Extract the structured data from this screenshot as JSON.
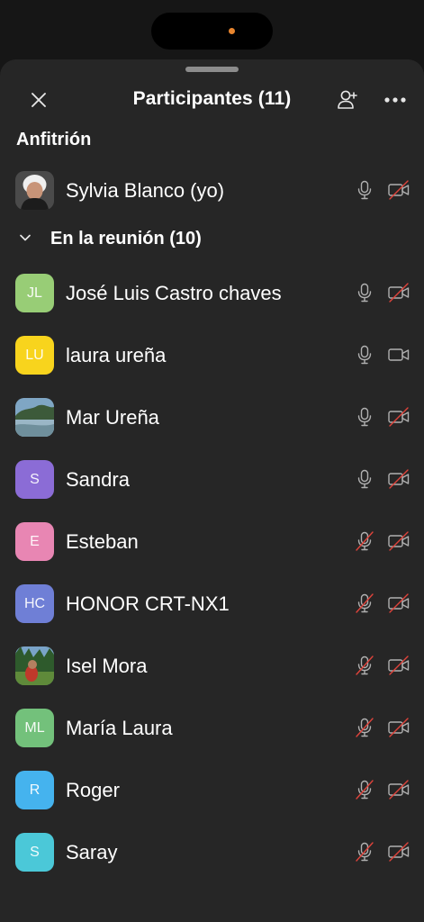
{
  "header": {
    "title": "Participantes (11)"
  },
  "host": {
    "section_label": "Anfitrión",
    "name": "Sylvia Blanco (yo)",
    "mic_muted": false,
    "cam_off": true
  },
  "group": {
    "label": "En la reunión (10)",
    "expanded": true
  },
  "participants": [
    {
      "initials": "JL",
      "name": "José Luis Castro chaves",
      "color": "#98cd76",
      "mic_muted": false,
      "cam_off": true
    },
    {
      "initials": "LU",
      "name": "laura ureña",
      "color": "#f8d41d",
      "mic_muted": false,
      "cam_off": false
    },
    {
      "initials": "",
      "name": "Mar Ureña",
      "color": "#5a7a8c",
      "mic_muted": false,
      "cam_off": true,
      "photo": "landscape"
    },
    {
      "initials": "S",
      "name": "Sandra",
      "color": "#8b6cd6",
      "mic_muted": false,
      "cam_off": true
    },
    {
      "initials": "E",
      "name": "Esteban",
      "color": "#e886b3",
      "mic_muted": true,
      "cam_off": true
    },
    {
      "initials": "HC",
      "name": "HONOR CRT-NX1",
      "color": "#6f7fd6",
      "mic_muted": true,
      "cam_off": true
    },
    {
      "initials": "",
      "name": "Isel Mora",
      "color": "#4a7a3e",
      "mic_muted": true,
      "cam_off": true,
      "photo": "forest"
    },
    {
      "initials": "ML",
      "name": "María Laura",
      "color": "#73c17b",
      "mic_muted": true,
      "cam_off": true
    },
    {
      "initials": "R",
      "name": "Roger",
      "color": "#45b3ee",
      "mic_muted": true,
      "cam_off": true
    },
    {
      "initials": "S",
      "name": "Saray",
      "color": "#4bc8d8",
      "mic_muted": true,
      "cam_off": true
    }
  ],
  "colors": {
    "sheet": "#262626",
    "icon": "#b0b0b0",
    "slash": "#e0433b",
    "status_dot": "#e8852e"
  },
  "icons": {
    "close": "close-icon",
    "invite": "person-add-icon",
    "more": "more-horizontal-icon",
    "mic": "microphone-icon",
    "cam": "video-camera-icon",
    "chevron": "chevron-down-icon"
  }
}
